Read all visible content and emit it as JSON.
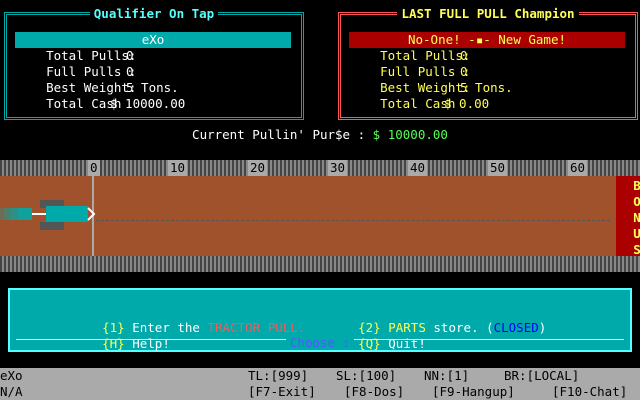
{
  "qualifier": {
    "title": "Qualifier On Tap",
    "name": "eXo",
    "total_pulls_label": "Total Pulls:",
    "total_pulls": "0",
    "full_pulls_label": "Full Pulls :",
    "full_pulls": "0",
    "best_weight_label": "Best Weight:",
    "best_weight": "5 Tons.",
    "total_cash_label": "Total Cash",
    "total_cash": "$ 10000.00"
  },
  "champion": {
    "title": "LAST FULL PULL Champion",
    "name": "No-One! -▪- New Game!",
    "total_pulls_label": "Total Pulls:",
    "total_pulls": "0",
    "full_pulls_label": "Full Pulls :",
    "full_pulls": "0",
    "best_weight_label": "Best Weight:",
    "best_weight": "5 Tons.",
    "total_cash_label": "Total Cash",
    "total_cash": "$ 0.00"
  },
  "purse": {
    "label": "Current Pullin' Pur$e :",
    "amount": "$ 10000.00"
  },
  "track": {
    "ticks": [
      "0",
      "10",
      "20",
      "30",
      "40",
      "50",
      "60"
    ],
    "bonus_letters": [
      "B",
      "O",
      "N",
      "U",
      "S"
    ]
  },
  "menu": {
    "item1_key": "{1}",
    "item1_text": "Enter the",
    "item1_highlight": "TRACTOR PULL.",
    "item2_key": "{2}",
    "item2_highlight": "PARTS",
    "item2_text": "store.",
    "item2_status": "CLOSED",
    "itemH_key": "{H}",
    "itemH_text": "Help!",
    "itemQ_key": "{Q}",
    "itemQ_text": "Quit!",
    "prompt": "Choose :"
  },
  "statusbar": {
    "user": "eXo",
    "tl": "TL:[999]",
    "sl": "SL:[100]",
    "nn": "NN:[1]",
    "br": "BR:[LOCAL]",
    "line2_left": "N/A",
    "f7": "[F7-Exit]",
    "f8": "[F8-Dos]",
    "f9": "[F9-Hangup]",
    "f10": "[F10-Chat]"
  },
  "colors": {
    "cyan": "#00aaaa",
    "red": "#ff5555",
    "yellow": "#ffff55",
    "green": "#55ff55",
    "track_dirt": "#a0522d"
  }
}
